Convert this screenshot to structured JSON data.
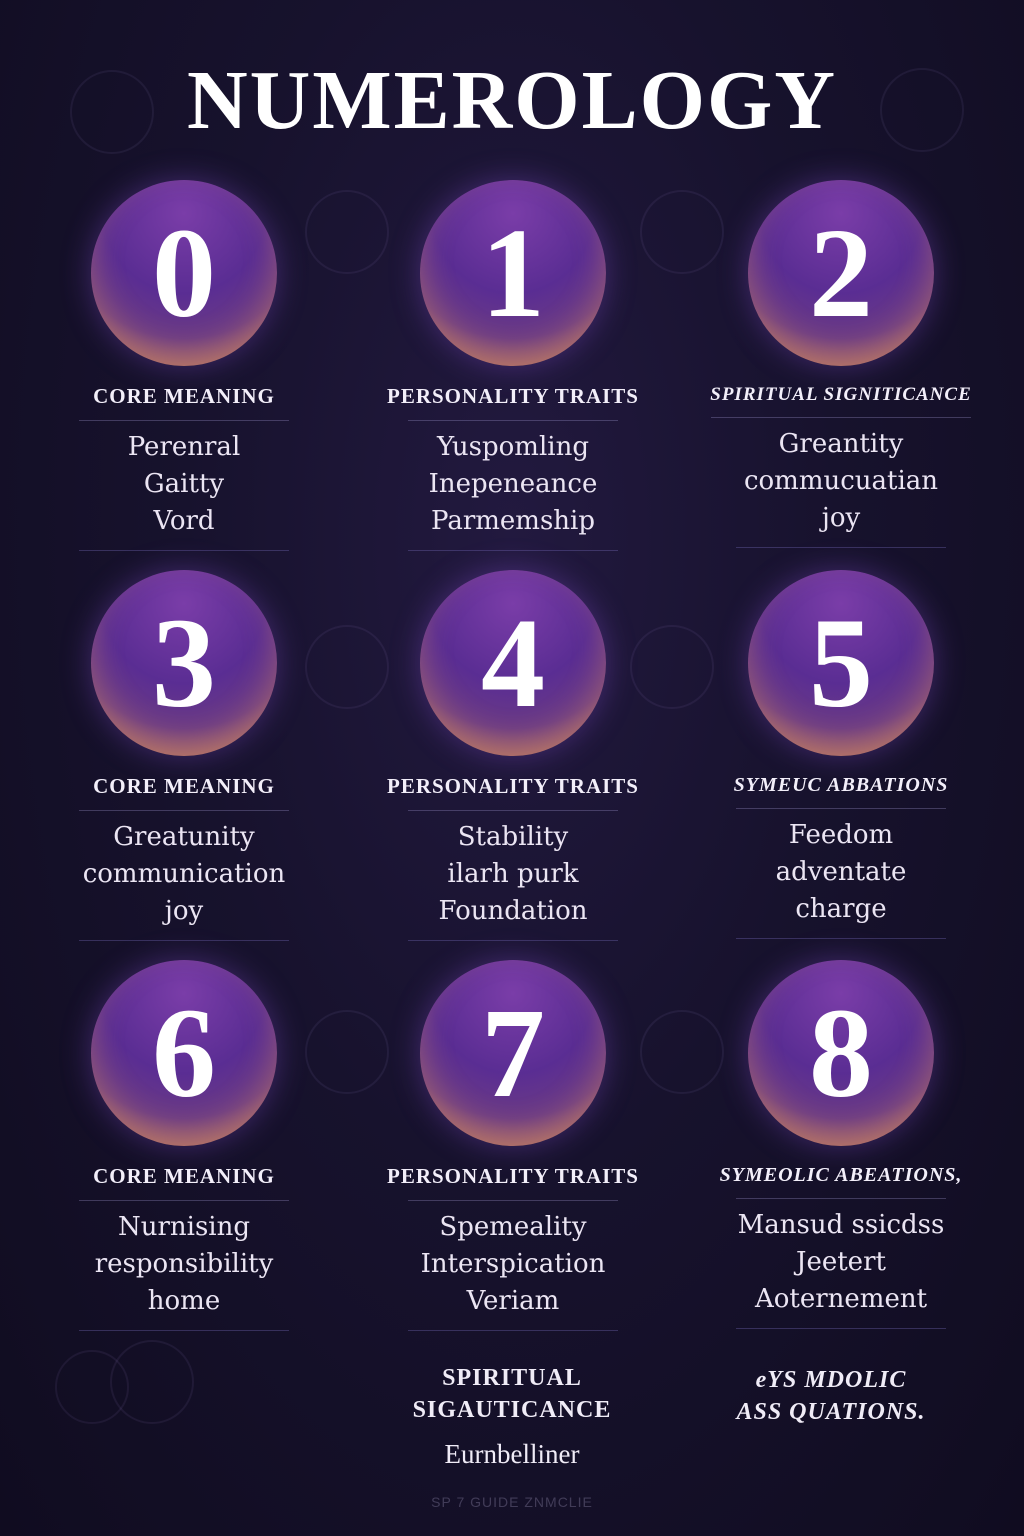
{
  "title": "NUMEROLOGY",
  "cards": [
    {
      "number": "0",
      "heading": "CORE MEANING",
      "lines": [
        "Perenral",
        "Gaitty",
        "Vord"
      ]
    },
    {
      "number": "1",
      "heading": "PERSONALITY TRAITS",
      "lines": [
        "Yuspomling",
        "Inepeneance",
        "Parmemship"
      ]
    },
    {
      "number": "2",
      "heading": "SPIRITUAL SIGNITICANCE",
      "lines": [
        "Greantity",
        "commucuatian",
        "joy"
      ]
    },
    {
      "number": "3",
      "heading": "CORE MEANING",
      "lines": [
        "Greatunity",
        "communication",
        "joy"
      ]
    },
    {
      "number": "4",
      "heading": "PERSONALITY TRAITS",
      "lines": [
        "Stability",
        "ilarh purk",
        "Foundation"
      ]
    },
    {
      "number": "5",
      "heading": "SYMEUC ABBATIONS",
      "lines": [
        "Feedom",
        "adventate",
        "charge"
      ]
    },
    {
      "number": "6",
      "heading": "CORE MEANING",
      "lines": [
        "Nurnising",
        "responsibility",
        "home"
      ]
    },
    {
      "number": "7",
      "heading": "PERSONALITY TRAITS",
      "lines": [
        "Spemeality",
        "Interspication",
        "Veriam"
      ]
    },
    {
      "number": "8",
      "heading": "SYMEOLIC ABEATIONS,",
      "lines": [
        "Mansud ssicdss",
        "Jeetert",
        "Aoternement"
      ]
    }
  ],
  "bottom": [
    {
      "line1": "SPIRITUAL",
      "line2": "SIGAUTICANCE",
      "sub": "Eurnbelliner"
    },
    {
      "line1": "eYS MDOLIC",
      "line2": "ASS QUATIONS."
    }
  ],
  "footnote": "SP 7 GUIDE ZNMCLIE"
}
